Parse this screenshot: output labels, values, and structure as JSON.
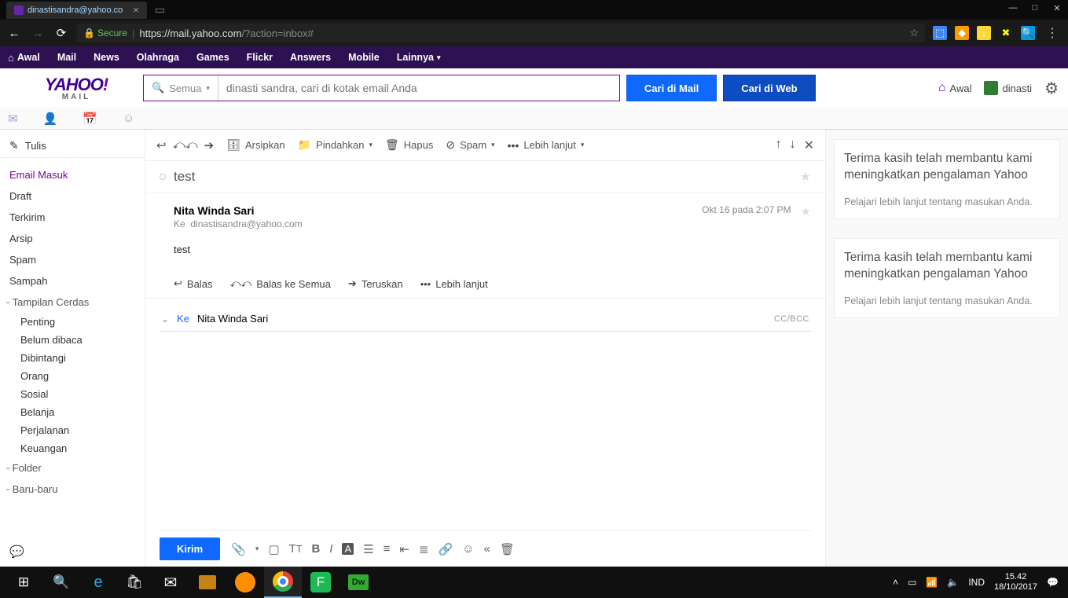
{
  "browser": {
    "tab_title": "dinastisandra@yahoo.co",
    "secure_label": "Secure",
    "url_host": "https://mail.yahoo.com",
    "url_path": "/?action=inbox#"
  },
  "uhf": {
    "items": [
      "Awal",
      "Mail",
      "News",
      "Olahraga",
      "Games",
      "Flickr",
      "Answers",
      "Mobile",
      "Lainnya"
    ]
  },
  "search": {
    "scope": "Semua",
    "placeholder": "dinasti sandra, cari di kotak email Anda",
    "btn_mail": "Cari di Mail",
    "btn_web": "Cari di Web",
    "link_home": "Awal",
    "link_user": "dinasti"
  },
  "sidebar": {
    "compose": "Tulis",
    "folders": [
      "Email Masuk",
      "Draft",
      "Terkirim",
      "Arsip",
      "Spam",
      "Sampah"
    ],
    "section_smart": "Tampilan Cerdas",
    "smart": [
      "Penting",
      "Belum dibaca",
      "Dibintangi",
      "Orang",
      "Sosial",
      "Belanja",
      "Perjalanan",
      "Keuangan"
    ],
    "section_folder": "Folder",
    "section_recent": "Baru-baru"
  },
  "toolbar": {
    "archive": "Arsipkan",
    "move": "Pindahkan",
    "delete": "Hapus",
    "spam": "Spam",
    "more": "Lebih lanjut"
  },
  "message": {
    "subject": "test",
    "from": "Nita Winda Sari",
    "to_label": "Ke",
    "to_addr": "dinastisandra@yahoo.com",
    "date": "Okt 16 pada 2:07 PM",
    "body": "test",
    "reply": "Balas",
    "reply_all": "Balas ke Semua",
    "forward": "Teruskan",
    "more": "Lebih lanjut"
  },
  "compose": {
    "to_label": "Ke",
    "to_name": "Nita Winda Sari",
    "ccbcc": "CC/BCC",
    "send": "Kirim"
  },
  "rail": {
    "card1_h": "Terima kasih telah membantu kami meningkatkan pengalaman Yahoo",
    "card1_s": "Pelajari lebih lanjut tentang masukan Anda.",
    "card2_h": "Terima kasih telah membantu kami meningkatkan pengalaman Yahoo",
    "card2_s": "Pelajari lebih lanjut tentang masukan Anda."
  },
  "taskbar": {
    "lang": "IND",
    "time": "15.42",
    "date": "18/10/2017"
  }
}
